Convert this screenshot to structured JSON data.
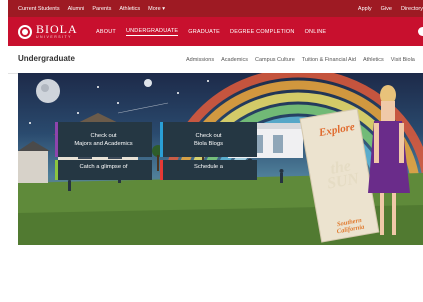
{
  "utility_bar": {
    "left_links": [
      "Current Students",
      "Alumni",
      "Parents",
      "Athletics",
      "More ▾"
    ],
    "right_links": [
      "Apply",
      "Give",
      "Directory"
    ]
  },
  "main_nav": {
    "logo_name": "BIOLA",
    "logo_subtitle": "UNIVERSITY",
    "links": [
      "ABOUT",
      "UNDERGRADUATE",
      "GRADUATE",
      "DEGREE COMPLETION",
      "ONLINE"
    ],
    "active_link": "UNDERGRADUATE"
  },
  "sub_nav": {
    "section_title": "Undergraduate",
    "links": [
      "Admissions",
      "Academics",
      "Campus Culture",
      "Tuition & Financial Aid",
      "Athletics",
      "Visit Biola"
    ]
  },
  "hero": {
    "poster_lines": [
      "Explore",
      "the",
      "SUN",
      "Southern California"
    ],
    "ctas": [
      {
        "line1": "Check out",
        "line2": "Majors and Academics",
        "accent": "#8e44ad"
      },
      {
        "line1": "Check out",
        "line2": "Biola Blogs",
        "accent": "#2a9fd6"
      },
      {
        "line1": "Catch a glimpse of",
        "line2": "",
        "accent": "#8cc63f"
      },
      {
        "line1": "Schedule a",
        "line2": "",
        "accent": "#e53935"
      }
    ]
  },
  "colors": {
    "utility_bar": "#9e1a23",
    "main_nav": "#c8102e"
  }
}
